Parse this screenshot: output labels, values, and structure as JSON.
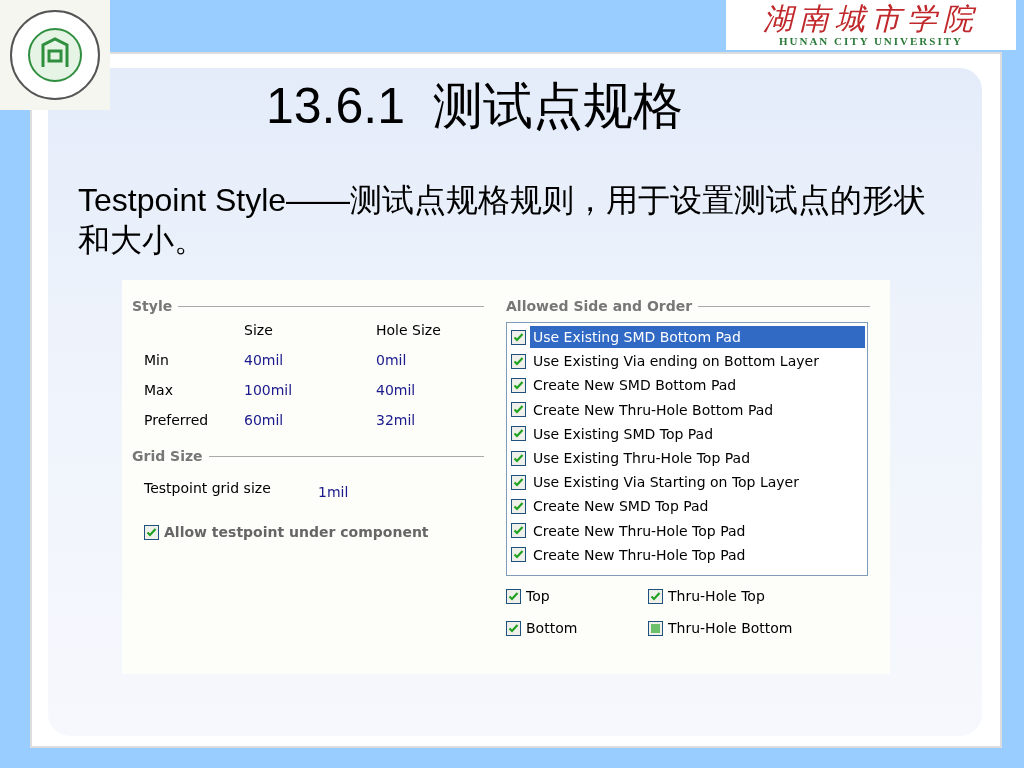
{
  "header": {
    "logo_cn": "湖南城市学院",
    "logo_en": "HUNAN CITY UNIVERSITY"
  },
  "title": "13.6.1  测试点规格",
  "body": "Testpoint Style——测试点规格规则，用于设置测试点的形状和大小。",
  "dialog": {
    "style": {
      "title": "Style",
      "columns": [
        "Size",
        "Hole Size"
      ],
      "rows": [
        {
          "label": "Min",
          "size": "40mil",
          "hole_size": "0mil"
        },
        {
          "label": "Max",
          "size": "100mil",
          "hole_size": "40mil"
        },
        {
          "label": "Preferred",
          "size": "60mil",
          "hole_size": "32mil"
        }
      ]
    },
    "grid": {
      "title": "Grid Size",
      "label": "Testpoint grid size",
      "value": "1mil"
    },
    "allow_under_component": {
      "label": "Allow testpoint under component",
      "checked": true
    },
    "allowed": {
      "title": "Allowed Side and Order",
      "items": [
        {
          "label": "Use Existing SMD Bottom Pad",
          "checked": true,
          "selected": true
        },
        {
          "label": "Use Existing Via ending on Bottom Layer",
          "checked": true,
          "selected": false
        },
        {
          "label": "Create New SMD Bottom Pad",
          "checked": true,
          "selected": false
        },
        {
          "label": "Create New Thru-Hole Bottom Pad",
          "checked": true,
          "selected": false
        },
        {
          "label": "Use Existing SMD Top Pad",
          "checked": true,
          "selected": false
        },
        {
          "label": "Use Existing Thru-Hole Top Pad",
          "checked": true,
          "selected": false
        },
        {
          "label": "Use Existing Via Starting on Top Layer",
          "checked": true,
          "selected": false
        },
        {
          "label": "Create New SMD Top Pad",
          "checked": true,
          "selected": false
        },
        {
          "label": "Create New Thru-Hole Top Pad",
          "checked": true,
          "selected": false
        },
        {
          "label": "Create New Thru-Hole Top Pad",
          "checked": true,
          "selected": false
        }
      ]
    },
    "sides": [
      {
        "label": "Top",
        "checked": true
      },
      {
        "label": "Thru-Hole Top",
        "checked": true
      },
      {
        "label": "Bottom",
        "checked": true
      },
      {
        "label": "Thru-Hole Bottom",
        "checked": true,
        "indeterminate": true
      }
    ]
  }
}
